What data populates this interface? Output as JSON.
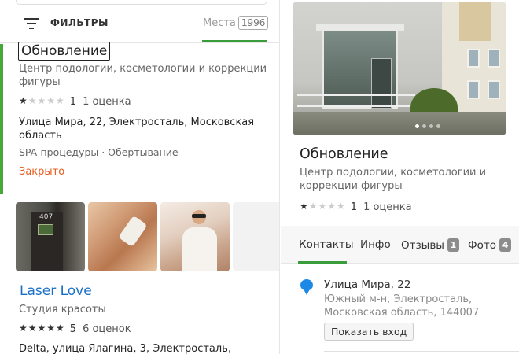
{
  "topbar": {
    "filters_label": "ФИЛЬТРЫ",
    "places_label": "Места",
    "places_count": "1996"
  },
  "list": [
    {
      "name": "Обновление",
      "subtitle_line1": "Центр подологии, косметологии и коррекции",
      "subtitle_line2": "фигуры",
      "stars_filled": 1,
      "stars_total": 5,
      "rating": "1",
      "reviews": "1 оценка",
      "address_line1": "Улица Мира, 22, Электросталь, Московская",
      "address_line2": "область",
      "tags": "SPA-процедуры · Обертывание",
      "status": "Закрыто",
      "status_color": "#e85c1e"
    },
    {
      "name": "Laser Love",
      "subtitle": "Студия красоты",
      "stars_filled": 5,
      "stars_total": 5,
      "rating": "5",
      "reviews": "6 оценок",
      "address_line1": "Delta, улица Ялагина, 3, Электросталь,",
      "photo_door_number": "407"
    }
  ],
  "detail": {
    "name": "Обновление",
    "subtitle": "Центр подологии, косметологии и коррекции фигуры",
    "stars_filled": 1,
    "stars_total": 5,
    "rating": "1",
    "reviews": "1 оценка",
    "photo_count_dots": 4,
    "photo_active_dot": 0,
    "tabs": [
      {
        "label": "Контакты",
        "badge": ""
      },
      {
        "label": "Инфо",
        "badge": ""
      },
      {
        "label": "Отзывы",
        "badge": "1"
      },
      {
        "label": "Фото",
        "badge": "4"
      }
    ],
    "active_tab": "Контакты",
    "address": "Улица Мира, 22",
    "area_line1": "Южный м-н, Электросталь,",
    "area_line2": "Московская область, 144007",
    "entrance_button": "Показать вход"
  },
  "colors": {
    "accent_green": "#3a9c3a",
    "link_blue": "#1a6fc7",
    "pin_blue": "#1e88e5",
    "closed_orange": "#e85c1e"
  }
}
